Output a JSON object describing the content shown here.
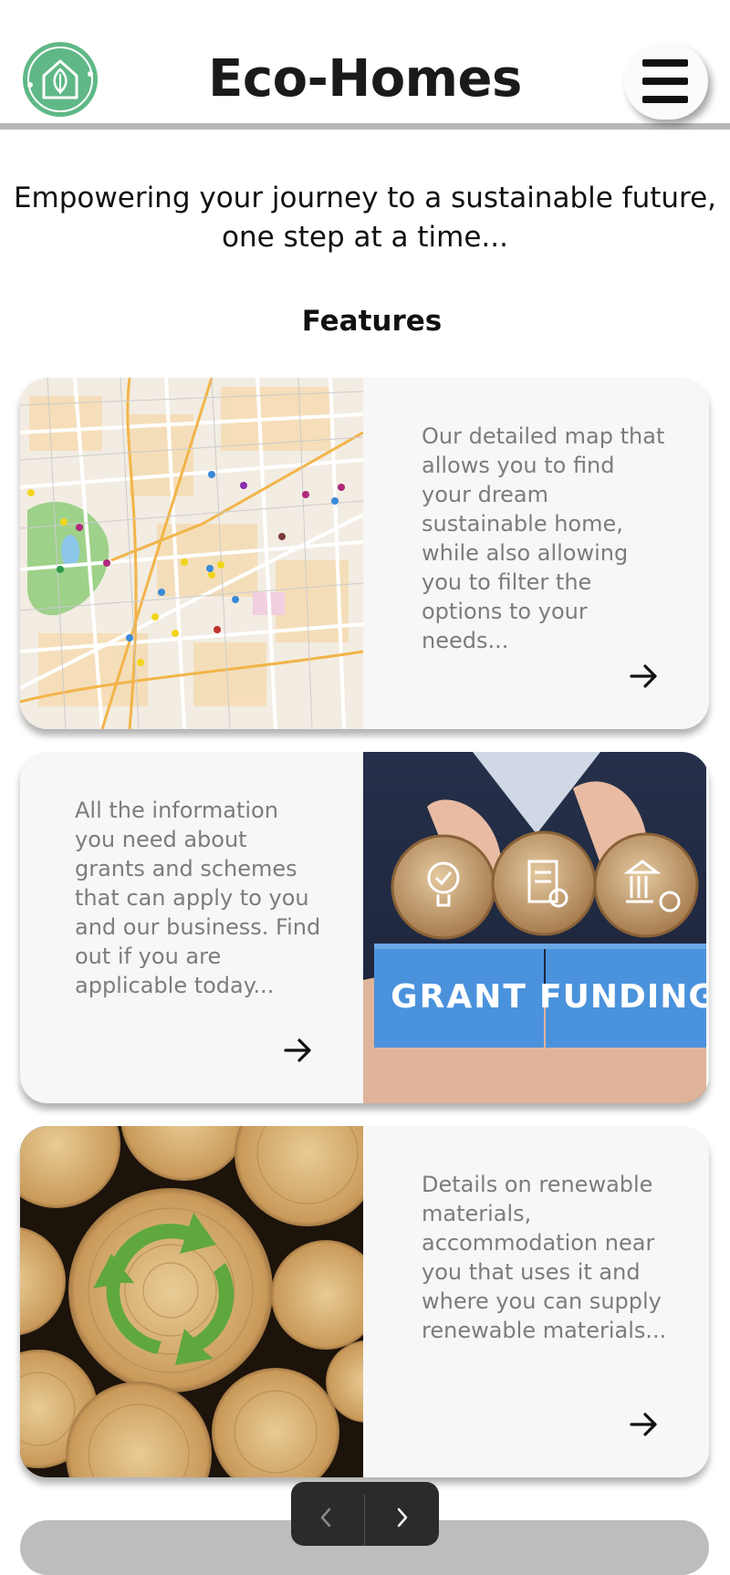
{
  "header": {
    "title": "Eco-Homes",
    "logo_icon": "leaf-home-icon",
    "menu_icon": "hamburger-menu-icon"
  },
  "tagline": "Empowering your journey to a sustainable future, one step at a time...",
  "features": {
    "title": "Features",
    "cards": [
      {
        "image_icon": "city-map-image",
        "description": "Our detailed map that allows you to find your dream sustainable home, while also allowing you to filter the options to your needs...",
        "arrow_icon": "arrow-right-icon"
      },
      {
        "image_icon": "grant-funding-image",
        "image_text": [
          "GRANT",
          "FUNDING"
        ],
        "description": "All the information you need about grants and schemes that can apply to you and our business. Find out if you are applicable today...",
        "arrow_icon": "arrow-right-icon"
      },
      {
        "image_icon": "recycled-wood-logs-image",
        "description": "Details on renewable materials, accommodation near you that uses it and where you can supply renewable materials...",
        "arrow_icon": "arrow-right-icon"
      }
    ]
  },
  "pager": {
    "prev_icon": "chevron-left-icon",
    "next_icon": "chevron-right-icon"
  },
  "colors": {
    "brand_green": "#5fb886",
    "card_background": "#f7f7f7",
    "description_text": "#7c7c7c",
    "header_border": "#b7b7b7"
  }
}
